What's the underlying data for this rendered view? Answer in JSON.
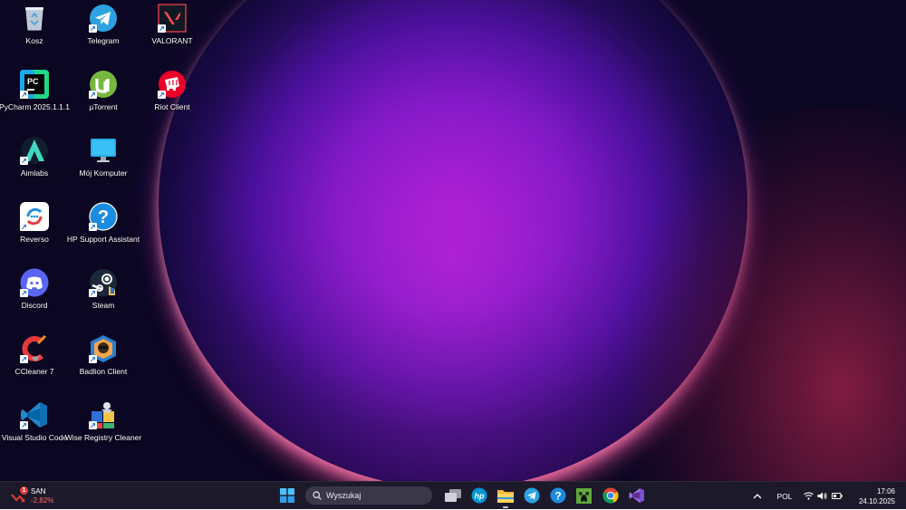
{
  "desktop": {
    "icons": [
      {
        "label": "Kosz",
        "icon": "recycle-bin-icon"
      },
      {
        "label": "Telegram",
        "icon": "telegram-icon"
      },
      {
        "label": "VALORANT",
        "icon": "valorant-icon"
      },
      {
        "label": "PyCharm 2025.1.1.1",
        "icon": "pycharm-icon"
      },
      {
        "label": "µTorrent",
        "icon": "utorrent-icon"
      },
      {
        "label": "Riot Client",
        "icon": "riot-client-icon"
      },
      {
        "label": "Aimlabs",
        "icon": "aimlabs-icon"
      },
      {
        "label": "Mój Komputer",
        "icon": "monitor-icon"
      },
      {
        "label": "Reverso",
        "icon": "reverso-icon"
      },
      {
        "label": "HP Support Assistant",
        "icon": "help-icon"
      },
      {
        "label": "Discord",
        "icon": "discord-icon"
      },
      {
        "label": "Steam",
        "icon": "steam-icon"
      },
      {
        "label": "CCleaner 7",
        "icon": "ccleaner-icon"
      },
      {
        "label": "Badlion Client",
        "icon": "badlion-icon"
      },
      {
        "label": "Visual Studio Code",
        "icon": "vscode-icon"
      },
      {
        "label": "Wise Registry Cleaner",
        "icon": "wise-registry-icon"
      }
    ]
  },
  "taskbar": {
    "widget": {
      "ticker": "SAN",
      "change": "-2,82%",
      "badge": "1"
    },
    "search": {
      "placeholder": "Wyszukaj"
    },
    "apps": [
      {
        "name": "task-view",
        "icon": "task-view-icon"
      },
      {
        "name": "hp",
        "icon": "hp-icon",
        "label": "hp"
      },
      {
        "name": "file-explorer",
        "icon": "folder-icon"
      },
      {
        "name": "telegram",
        "icon": "telegram-icon"
      },
      {
        "name": "help",
        "icon": "help-icon",
        "label": "?"
      },
      {
        "name": "minecraft",
        "icon": "minecraft-icon"
      },
      {
        "name": "chrome",
        "icon": "chrome-icon"
      },
      {
        "name": "visual-studio",
        "icon": "visual-studio-icon"
      }
    ],
    "tray": {
      "language": "POL",
      "time": "17:06",
      "date": "24.10.2025"
    }
  },
  "colors": {
    "taskbar_bg": "#1c1a2a",
    "accent": "#0078d4",
    "negative": "#ff6b6b"
  }
}
